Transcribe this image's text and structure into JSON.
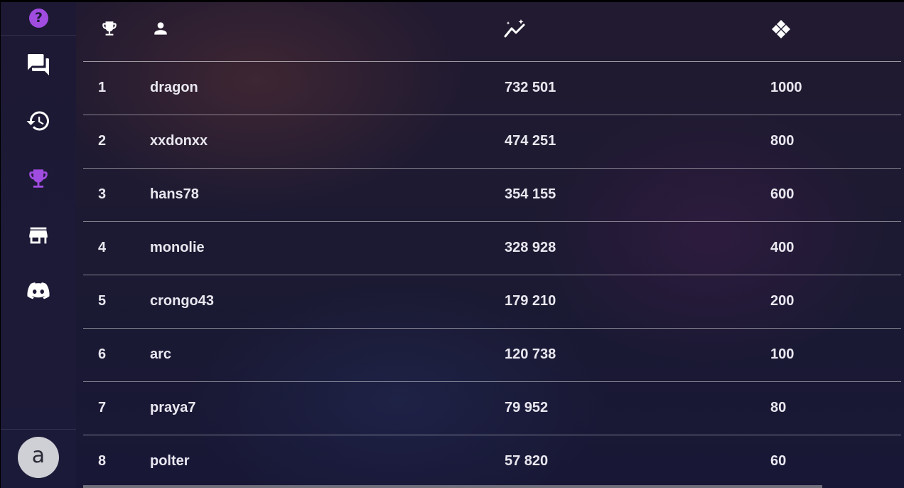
{
  "sidebar": {
    "help": {
      "glyph": "?",
      "icon": "help-circle-icon",
      "color": "#a04ce0"
    },
    "items": [
      {
        "name": "chat",
        "icon": "chat-icon"
      },
      {
        "name": "history",
        "icon": "history-icon"
      },
      {
        "name": "leaderboard",
        "icon": "trophy-icon",
        "active": true,
        "color": "#a04ce0"
      },
      {
        "name": "store",
        "icon": "store-icon"
      },
      {
        "name": "discord",
        "icon": "discord-icon"
      }
    ],
    "avatar_letter": "a"
  },
  "leaderboard": {
    "header_icons": [
      "trophy-icon",
      "user-icon",
      "score-chart-icon",
      "diamond-icon"
    ],
    "rows": [
      {
        "rank": "1",
        "name": "dragon",
        "score": "732 501",
        "prize": "1000"
      },
      {
        "rank": "2",
        "name": "xxdonxx",
        "score": "474 251",
        "prize": "800"
      },
      {
        "rank": "3",
        "name": "hans78",
        "score": "354 155",
        "prize": "600"
      },
      {
        "rank": "4",
        "name": "monolie",
        "score": "328 928",
        "prize": "400"
      },
      {
        "rank": "5",
        "name": "crongo43",
        "score": "179 210",
        "prize": "200"
      },
      {
        "rank": "6",
        "name": "arc",
        "score": "120 738",
        "prize": "100"
      },
      {
        "rank": "7",
        "name": "praya7",
        "score": "79 952",
        "prize": "80"
      },
      {
        "rank": "8",
        "name": "polter",
        "score": "57 820",
        "prize": "60"
      }
    ]
  }
}
